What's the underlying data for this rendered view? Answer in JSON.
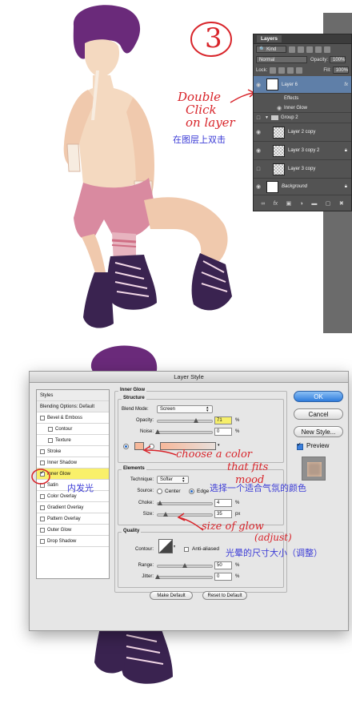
{
  "annotations": {
    "step_number": "3",
    "double_click": [
      "Double",
      "Click",
      "on layer"
    ],
    "double_click_cn": "在图层上双击",
    "choose_color": [
      "choose a color",
      "that fits",
      "mood"
    ],
    "choose_color_cn": "选择一个适合气氛的颜色",
    "inner_glow_cn": "内发光",
    "size_of_glow": [
      "size of glow",
      "(adjust)"
    ],
    "size_of_glow_cn": "光晕的尺寸大小（调整）"
  },
  "layers_panel": {
    "tab": "Layers",
    "kind_filter": "Kind",
    "blend_mode": "Normal",
    "opacity_label": "Opacity:",
    "opacity_value": "100%",
    "lock_label": "Lock:",
    "fill_label": "Fill:",
    "fill_value": "100%",
    "fx_label": "fx",
    "layers": [
      {
        "name": "Layer 6",
        "selected": true,
        "has_fx": true
      },
      {
        "name": "Effects"
      },
      {
        "name": "Inner Glow"
      },
      {
        "name": "Group 2"
      },
      {
        "name": "Layer 2 copy"
      },
      {
        "name": "Layer 3 copy 2"
      },
      {
        "name": "Layer 3 copy"
      },
      {
        "name": "Background"
      }
    ]
  },
  "dialog": {
    "title": "Layer Style",
    "styles_list": [
      {
        "label": "Styles",
        "header": true
      },
      {
        "label": "Blending Options: Default",
        "header": true
      },
      {
        "label": "Bevel & Emboss",
        "checked": false
      },
      {
        "label": "Contour",
        "checked": false,
        "sub": true
      },
      {
        "label": "Texture",
        "checked": false,
        "sub": true
      },
      {
        "label": "Stroke",
        "checked": false
      },
      {
        "label": "Inner Shadow",
        "checked": false
      },
      {
        "label": "Inner Glow",
        "checked": true,
        "selected": true
      },
      {
        "label": "Satin",
        "checked": false
      },
      {
        "label": "Color Overlay",
        "checked": false
      },
      {
        "label": "Gradient Overlay",
        "checked": false
      },
      {
        "label": "Pattern Overlay",
        "checked": false
      },
      {
        "label": "Outer Glow",
        "checked": false
      },
      {
        "label": "Drop Shadow",
        "checked": false
      }
    ],
    "inner_glow_title": "Inner Glow",
    "structure": {
      "title": "Structure",
      "blend_mode_label": "Blend Mode:",
      "blend_mode_value": "Screen",
      "opacity_label": "Opacity:",
      "opacity_value": "71",
      "opacity_fraction": 0.71,
      "noise_label": "Noise:",
      "noise_value": "0",
      "noise_fraction": 0,
      "percent": "%",
      "glow_color": "#f6b89a"
    },
    "elements": {
      "title": "Elements",
      "technique_label": "Technique:",
      "technique_value": "Softer",
      "source_label": "Source:",
      "source_center": "Center",
      "source_edge": "Edge",
      "choke_label": "Choke:",
      "choke_value": "4",
      "choke_fraction": 0.04,
      "size_label": "Size:",
      "size_value": "35",
      "size_fraction": 0.14,
      "percent": "%",
      "px": "px"
    },
    "quality": {
      "title": "Quality",
      "contour_label": "Contour:",
      "anti_aliased_label": "Anti-aliased",
      "range_label": "Range:",
      "range_value": "50",
      "range_fraction": 0.5,
      "jitter_label": "Jitter:",
      "jitter_value": "0",
      "jitter_fraction": 0,
      "percent": "%"
    },
    "make_default": "Make Default",
    "reset_default": "Reset to Default",
    "ok": "OK",
    "cancel": "Cancel",
    "new_style": "New Style...",
    "preview": "Preview"
  },
  "colors": {
    "annotation_red": "#d8242a",
    "annotation_blue": "#3b3bd6",
    "highlight_yellow": "#f9f06a",
    "hair_purple": "#6a2a7a",
    "skin": "#f4d9c0",
    "shorts_pink": "#d98aa0",
    "boots_purple": "#3a2350"
  }
}
